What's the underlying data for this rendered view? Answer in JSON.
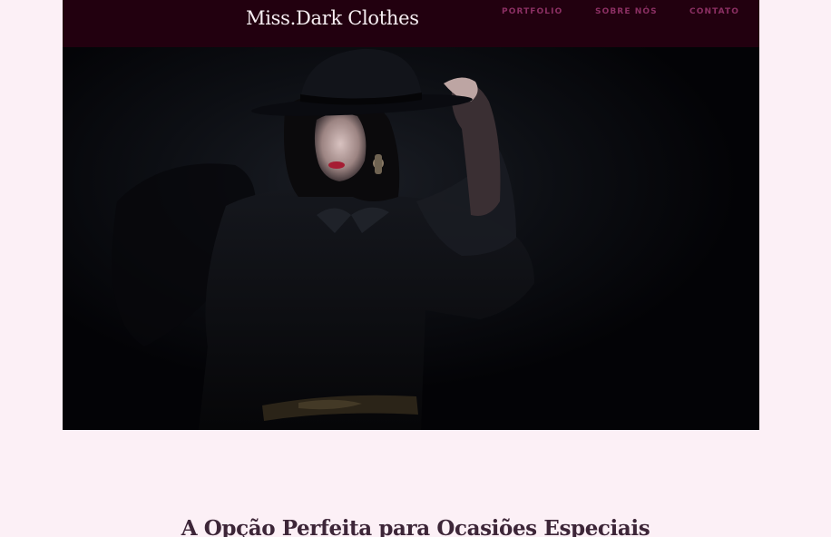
{
  "header": {
    "brand": "Miss.Dark Clothes",
    "nav": [
      {
        "label": "PORTFOLIO"
      },
      {
        "label": "SOBRE NÓS"
      },
      {
        "label": "CONTATO"
      }
    ]
  },
  "hero": {
    "image_icon": "woman-in-black-hat-photo"
  },
  "main": {
    "heading": "A Opção Perfeita para Ocasiões Especiais"
  },
  "colors": {
    "header_bg": "#22000f",
    "nav_text": "#8b2f63",
    "page_bg": "#fcf0f6",
    "heading_text": "#3d2638"
  }
}
